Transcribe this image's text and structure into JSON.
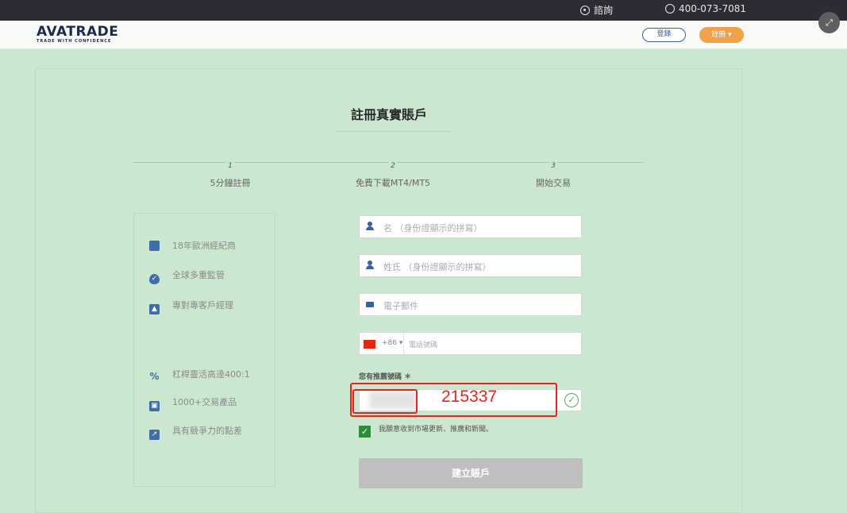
{
  "topbar": {
    "chat_label": "諮詢",
    "phone": "400-073-7081"
  },
  "header": {
    "logo": "AVATRADE",
    "logo_tagline": "TRADE WITH CONFIDENCE",
    "login_label": "登錄",
    "register_label": "註冊 ▾"
  },
  "form_title": "註冊真實賬戶",
  "steps": [
    {
      "num": "1",
      "label": "5分鐘註冊"
    },
    {
      "num": "2",
      "label": "免費下載MT4/MT5"
    },
    {
      "num": "3",
      "label": "開始交易"
    }
  ],
  "features_top": [
    {
      "icon": "document-icon",
      "label": "18年歐洲經紀商"
    },
    {
      "icon": "shield-icon",
      "label": "全球多重監管"
    },
    {
      "icon": "person-icon",
      "label": "專對專客戶經理"
    }
  ],
  "features_bottom": [
    {
      "icon": "percent-icon",
      "label": "杠桿靈活高達400:1",
      "glyph": "%"
    },
    {
      "icon": "image-icon",
      "label": "1000+交易產品"
    },
    {
      "icon": "chart-icon",
      "label": "具有競爭力的點差"
    }
  ],
  "fields": {
    "first_name_placeholder": "名 （身份證顯示的拼寫）",
    "last_name_placeholder": "姓氏 （身份證顯示的拼寫）",
    "email_placeholder": "電子郵件",
    "phone_code": "+86 ▾",
    "phone_placeholder": "電話號碼"
  },
  "promo": {
    "label": "您有推薦號碼 ＊",
    "code_value": "215337"
  },
  "consent_text": "我願意收到市場更新、推廣和新聞。",
  "submit_label": "建立賬戶",
  "colors": {
    "accent": "#3c5fa0",
    "orange": "#f0a24a",
    "annotation_red": "#e3251d",
    "background": "#cce7cf"
  }
}
